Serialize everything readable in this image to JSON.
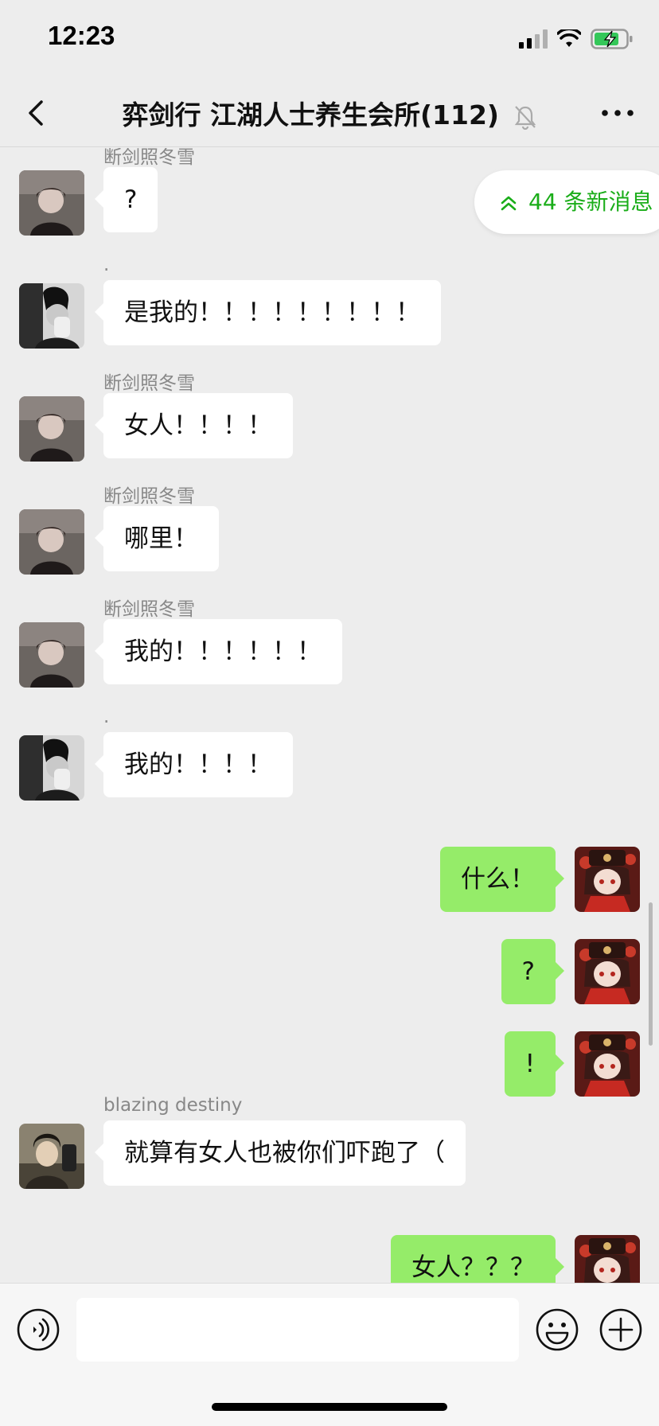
{
  "status_bar": {
    "time": "12:23"
  },
  "header": {
    "title": "弈剑行 江湖人士养生会所(112)"
  },
  "new_messages": {
    "label": "44 条新消息"
  },
  "messages": [
    {
      "sender": "断剑照冬雪",
      "text": "?",
      "side": "in",
      "avatar": "avatar-woman"
    },
    {
      "sender": ".",
      "text": "是我的！！！！！！！！！",
      "side": "in",
      "avatar": "avatar-bw-man"
    },
    {
      "sender": "断剑照冬雪",
      "text": "女人！！！！",
      "side": "in",
      "avatar": "avatar-woman"
    },
    {
      "sender": "断剑照冬雪",
      "text": "哪里！",
      "side": "in",
      "avatar": "avatar-woman"
    },
    {
      "sender": "断剑照冬雪",
      "text": "我的！！！！！！",
      "side": "in",
      "avatar": "avatar-woman"
    },
    {
      "sender": ".",
      "text": "我的！！！！",
      "side": "in",
      "avatar": "avatar-bw-man"
    },
    {
      "sender": "",
      "text": "什么！",
      "side": "out",
      "avatar": "avatar-anime"
    },
    {
      "sender": "",
      "text": "?",
      "side": "out",
      "avatar": "avatar-anime"
    },
    {
      "sender": "",
      "text": "!",
      "side": "out",
      "avatar": "avatar-anime"
    },
    {
      "sender": "blazing destiny",
      "text": "就算有女人也被你们吓跑了（",
      "side": "in",
      "avatar": "avatar-man-selfie"
    },
    {
      "sender": "",
      "text": "女人？？？",
      "side": "out",
      "avatar": "avatar-anime"
    }
  ],
  "input": {
    "value": "",
    "placeholder": ""
  },
  "colors": {
    "background": "#ededed",
    "bubble_out": "#95ec69",
    "bubble_in": "#ffffff",
    "accent": "#1aad19"
  }
}
